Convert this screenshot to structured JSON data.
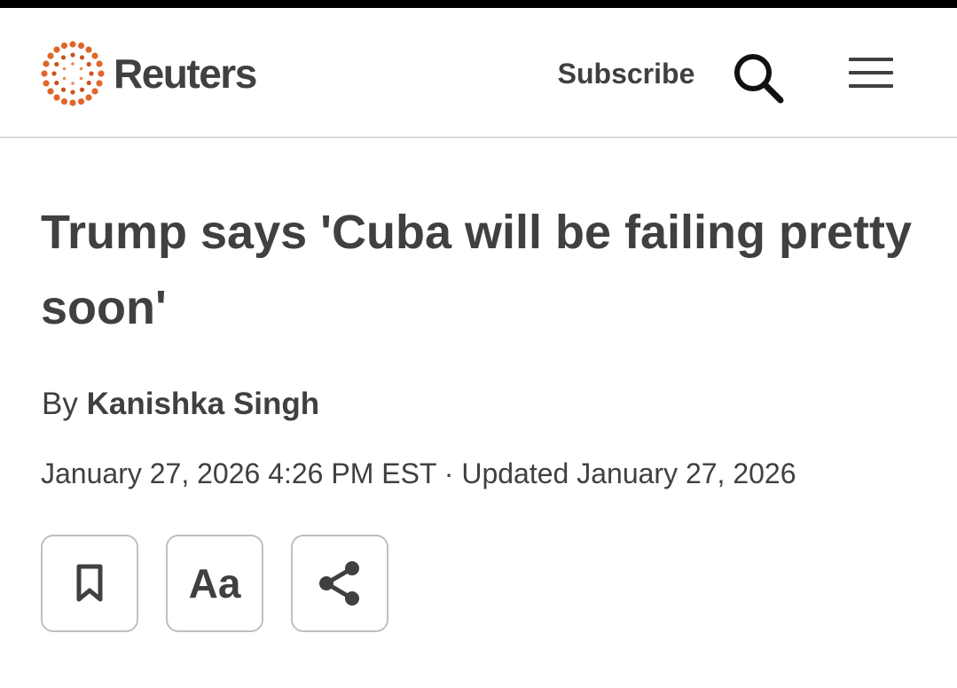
{
  "header": {
    "brand": "Reuters",
    "subscribe_label": "Subscribe",
    "search_icon": "search-icon",
    "menu_icon": "hamburger-menu-icon",
    "brand_color": "#FA6400"
  },
  "article": {
    "headline": "Trump says 'Cuba will be failing pretty soon'",
    "byline_prefix": "By",
    "author": "Kanishka Singh",
    "dateline": "January 27, 2026 4:26 PM EST · Updated January 27, 2026"
  },
  "actions": {
    "bookmark_icon": "bookmark-icon",
    "font_size_label": "Aa",
    "share_icon": "share-icon"
  }
}
